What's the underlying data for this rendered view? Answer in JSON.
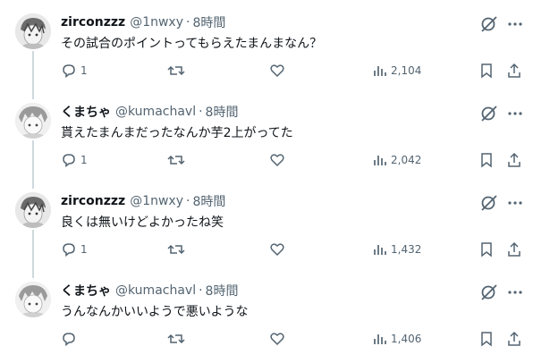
{
  "tweets": [
    {
      "name": "zirconzzz",
      "handle": "@1nwxy",
      "separator": "·",
      "time": "8時間",
      "text": "その試合のポイントってもらえたまんまなん？",
      "reply_count": "1",
      "views": "2,104",
      "avatar": "anime-character-avatar-icon"
    },
    {
      "name": "くまちゃ",
      "handle": "@kumachavl",
      "separator": "·",
      "time": "8時間",
      "text": "貰えたまんまだったなんか芋2上がってた",
      "reply_count": "1",
      "views": "2,042",
      "avatar": "anime-character-avatar-icon"
    },
    {
      "name": "zirconzzz",
      "handle": "@1nwxy",
      "separator": "·",
      "time": "8時間",
      "text": "良くは無いけどよかったね笑",
      "reply_count": "1",
      "views": "1,432",
      "avatar": "anime-character-avatar-icon"
    },
    {
      "name": "くまちゃ",
      "handle": "@kumachavl",
      "separator": "·",
      "time": "8時間",
      "text": "うんなんかいいようで悪いような",
      "reply_count": "",
      "views": "1,406",
      "avatar": "anime-character-avatar-icon"
    }
  ],
  "colors": {
    "text": "#0f1419",
    "muted": "#536471",
    "thread_line": "#cfd9de",
    "divider": "#eff3f4"
  },
  "icons": [
    "grok-icon",
    "more-icon",
    "reply-icon",
    "retweet-icon",
    "like-icon",
    "views-icon",
    "bookmark-icon",
    "share-icon"
  ]
}
